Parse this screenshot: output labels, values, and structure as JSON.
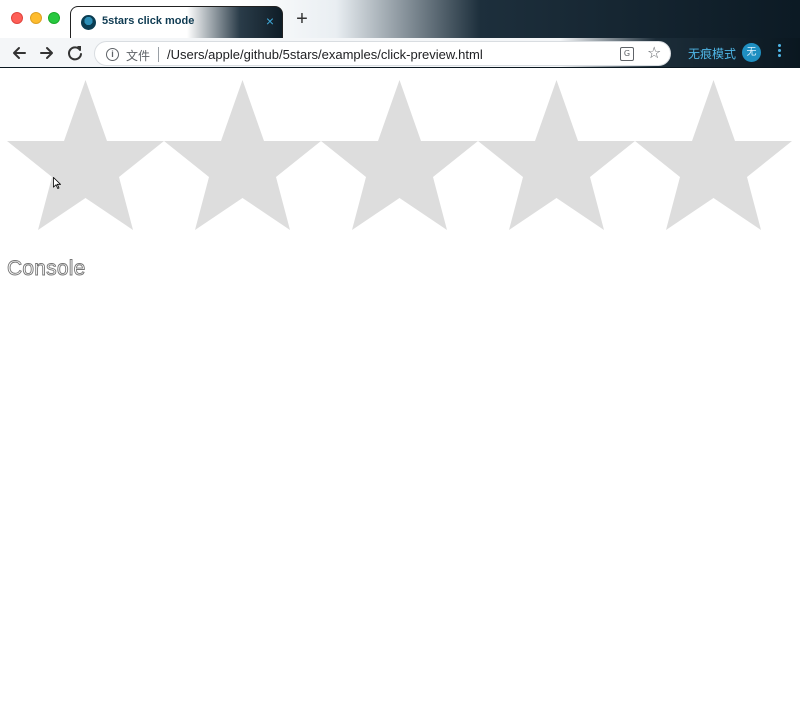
{
  "browser": {
    "tab": {
      "title": "5stars click mode",
      "close_symbol": "×",
      "favicon": "page-favicon"
    },
    "new_tab_symbol": "+",
    "address_bar": {
      "scheme_label": "文件",
      "url": "/Users/apple/github/5stars/examples/click-preview.html",
      "info_symbol": "i",
      "translate_symbol": "G",
      "bookmark_symbol": "☆"
    },
    "incognito_label": "无痕模式",
    "profile_initial": "无"
  },
  "rating": {
    "star_count": 5,
    "selected": 0,
    "star_color": "#dddddd"
  },
  "console": {
    "title": "Console",
    "entries": []
  },
  "colors": {
    "accent": "#4fb6e6",
    "star_empty": "#dddddd"
  }
}
